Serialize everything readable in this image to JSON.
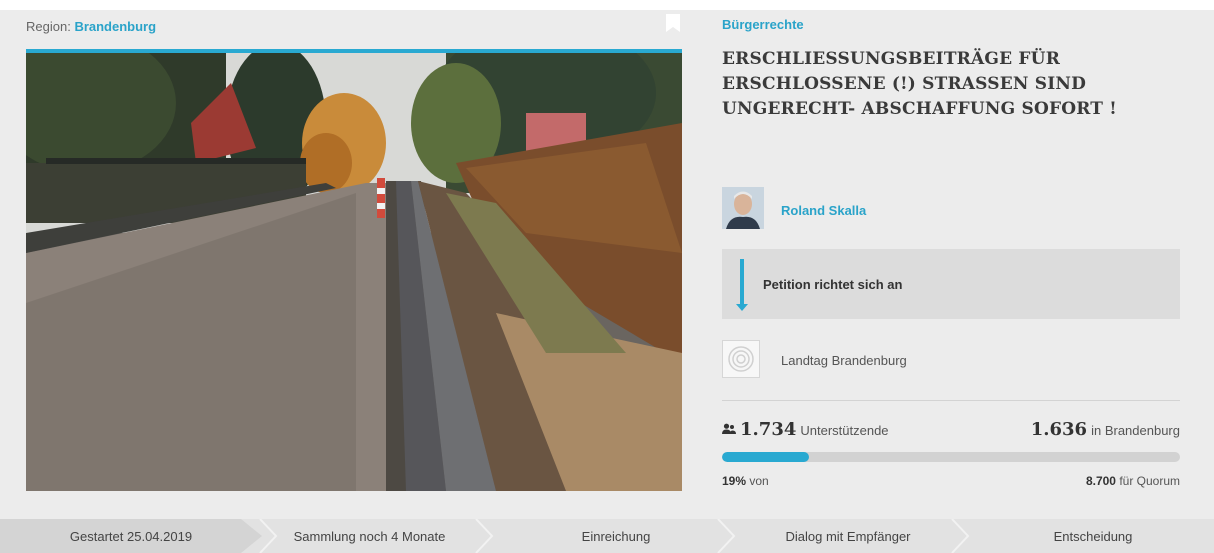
{
  "region": {
    "label": "Region:",
    "value": "Brandenburg"
  },
  "petition": {
    "category": "Bürgerrechte",
    "title": "ERSCHLIESSUNGSBEITRÄGE FÜR ERSCHLOSSENE (!) STRASSEN SIND UNGERECHT- ABSCHAFFUNG SOFORT !",
    "author": "Roland Skalla",
    "addressee_label": "Petition richtet sich an",
    "recipient": "Landtag Brandenburg"
  },
  "stats": {
    "supporters": "1.734",
    "supporters_label": "Unterstützende",
    "regional_supporters": "1.636",
    "regional_label": "in Brandenburg",
    "percent": "19%",
    "percent_label": "von",
    "progress_fraction": 0.19,
    "quorum": "8.700",
    "quorum_label": "für Quorum"
  },
  "steps": [
    {
      "label": "Gestartet 25.04.2019"
    },
    {
      "label": "Sammlung noch 4 Monate"
    },
    {
      "label": "Einreichung"
    },
    {
      "label": "Dialog mit Empfänger"
    },
    {
      "label": "Entscheidung"
    }
  ],
  "colors": {
    "accent": "#29a9d1",
    "background": "#ececec"
  },
  "icons": {
    "bookmark": "bookmark-icon",
    "supporters": "people-icon",
    "recipient": "target-icon",
    "arrow": "arrow-down-icon"
  }
}
